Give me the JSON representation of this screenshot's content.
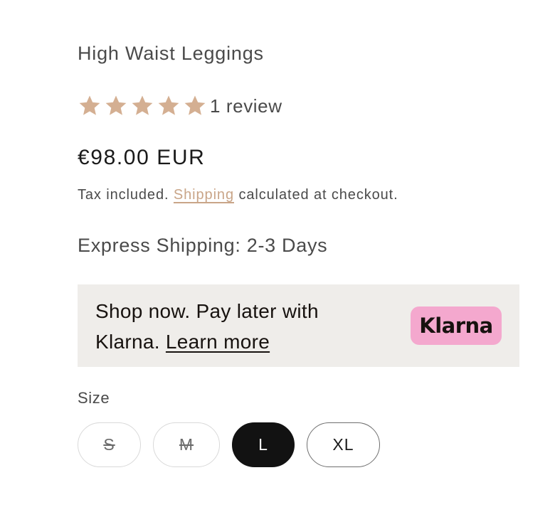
{
  "product": {
    "title": "High Waist Leggings",
    "rating": {
      "stars_filled": 5,
      "stars_total": 5,
      "review_text": "1 review",
      "star_color": "#d4af92"
    },
    "price": "€98.00 EUR",
    "tax_prefix": "Tax included.",
    "shipping_link": "Shipping",
    "tax_suffix": "calculated at checkout.",
    "express_shipping": "Express Shipping: 2-3 Days"
  },
  "klarna": {
    "line1": "Shop now. Pay later with",
    "line2_prefix": "Klarna.",
    "learn_more": "Learn more",
    "badge_text": "Klarna",
    "badge_color": "#f4a8ce",
    "box_color": "#efedea"
  },
  "size": {
    "label": "Size",
    "options": [
      {
        "label": "S",
        "state": "unavailable"
      },
      {
        "label": "M",
        "state": "unavailable"
      },
      {
        "label": "L",
        "state": "selected"
      },
      {
        "label": "XL",
        "state": "available"
      }
    ],
    "selected": "L"
  }
}
